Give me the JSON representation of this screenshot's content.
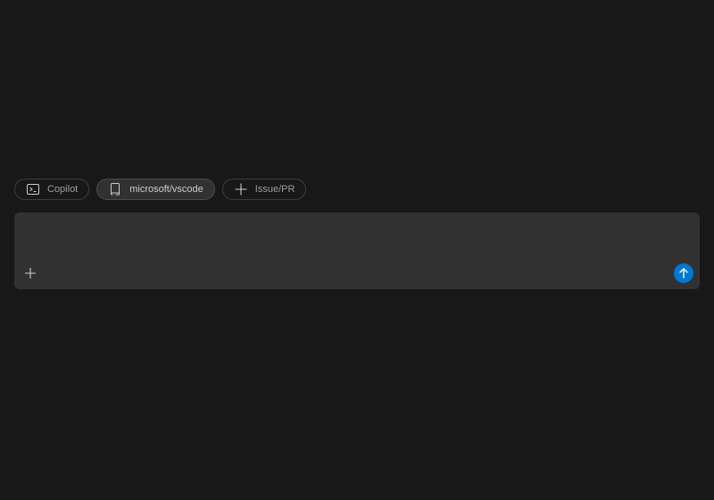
{
  "chips": [
    {
      "label": "Copilot",
      "icon": "terminal-icon",
      "active": false
    },
    {
      "label": "microsoft/vscode",
      "icon": "repo-icon",
      "active": true
    },
    {
      "label": "Issue/PR",
      "icon": "plus-icon",
      "active": false
    }
  ],
  "composer": {
    "placeholder": "",
    "attach_icon": "plus-icon",
    "send_icon": "arrow-up-icon"
  },
  "colors": {
    "background": "#181818",
    "composer": "#313131",
    "accent": "#0078d4",
    "chip_border": "#3c3c3c"
  }
}
